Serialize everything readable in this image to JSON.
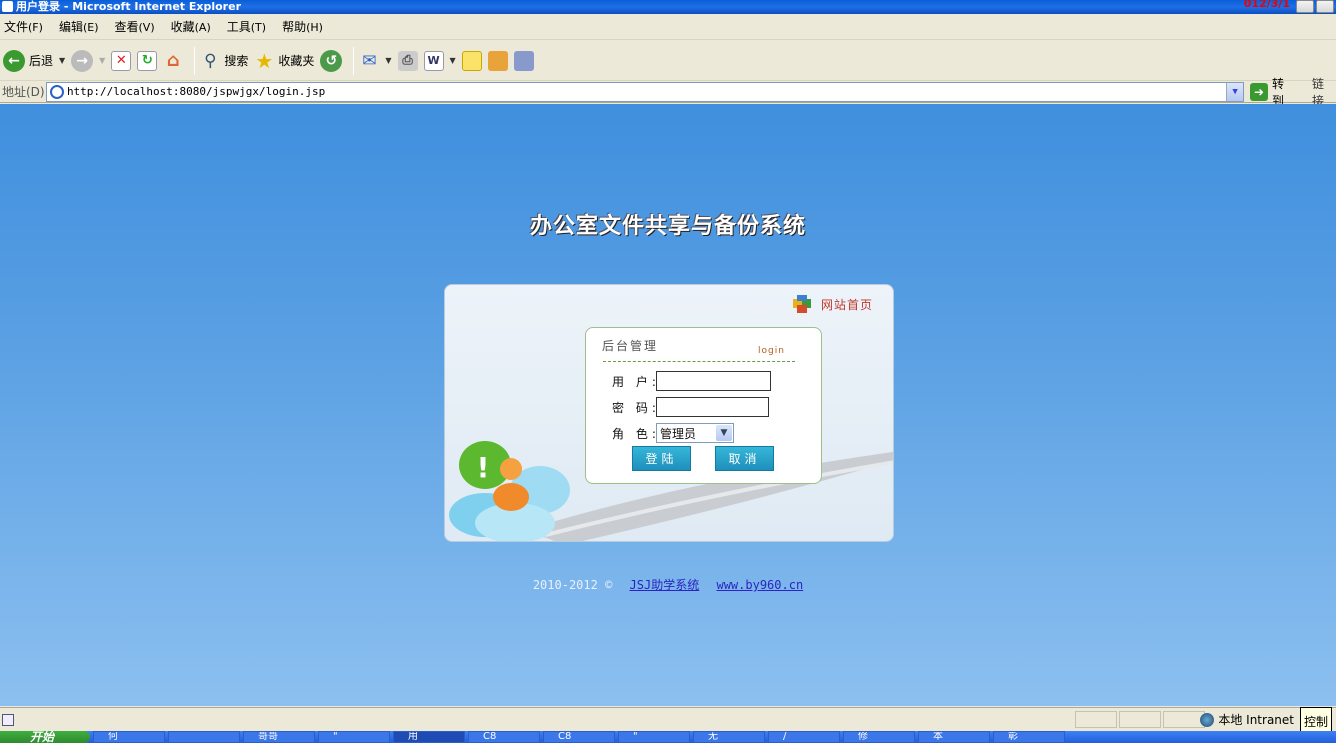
{
  "window": {
    "title": "用户登录 - Microsoft Internet Explorer",
    "corner_text": "012/3/1"
  },
  "menubar": {
    "items": [
      {
        "label": "文件",
        "acc": "(F)"
      },
      {
        "label": "编辑",
        "acc": "(E)"
      },
      {
        "label": "查看",
        "acc": "(V)"
      },
      {
        "label": "收藏",
        "acc": "(A)"
      },
      {
        "label": "工具",
        "acc": "(T)"
      },
      {
        "label": "帮助",
        "acc": "(H)"
      }
    ]
  },
  "toolbar": {
    "back_label": "后退",
    "search_label": "搜索",
    "favorites_label": "收藏夹"
  },
  "address": {
    "label": "地址(D)",
    "url": "http://localhost:8080/jspwjgx/login.jsp",
    "go_label": "转到",
    "links_label": "链接"
  },
  "page": {
    "system_title": "办公室文件共享与备份系统",
    "home_link": "网站首页",
    "form": {
      "heading": "后台管理",
      "login_tag": "login",
      "user_label": "用 户:",
      "password_label": "密 码:",
      "role_label": "角 色:",
      "user_value": "",
      "password_value": "",
      "role_selected": "管理员",
      "login_button": "登陆",
      "cancel_button": "取消"
    },
    "footer": {
      "copyright": "2010-2012 ©",
      "link1": "JSJ助学系统",
      "link2": "www.by960.cn"
    }
  },
  "statusbar": {
    "zone": "本地 Intranet",
    "tooltip": "控制"
  },
  "taskbar": {
    "start": "开始",
    "items": [
      "何",
      "",
      "哥哥",
      "\"",
      "用",
      "C8",
      "C8",
      "\"",
      "无",
      "/",
      "修",
      "本",
      "彰"
    ]
  }
}
